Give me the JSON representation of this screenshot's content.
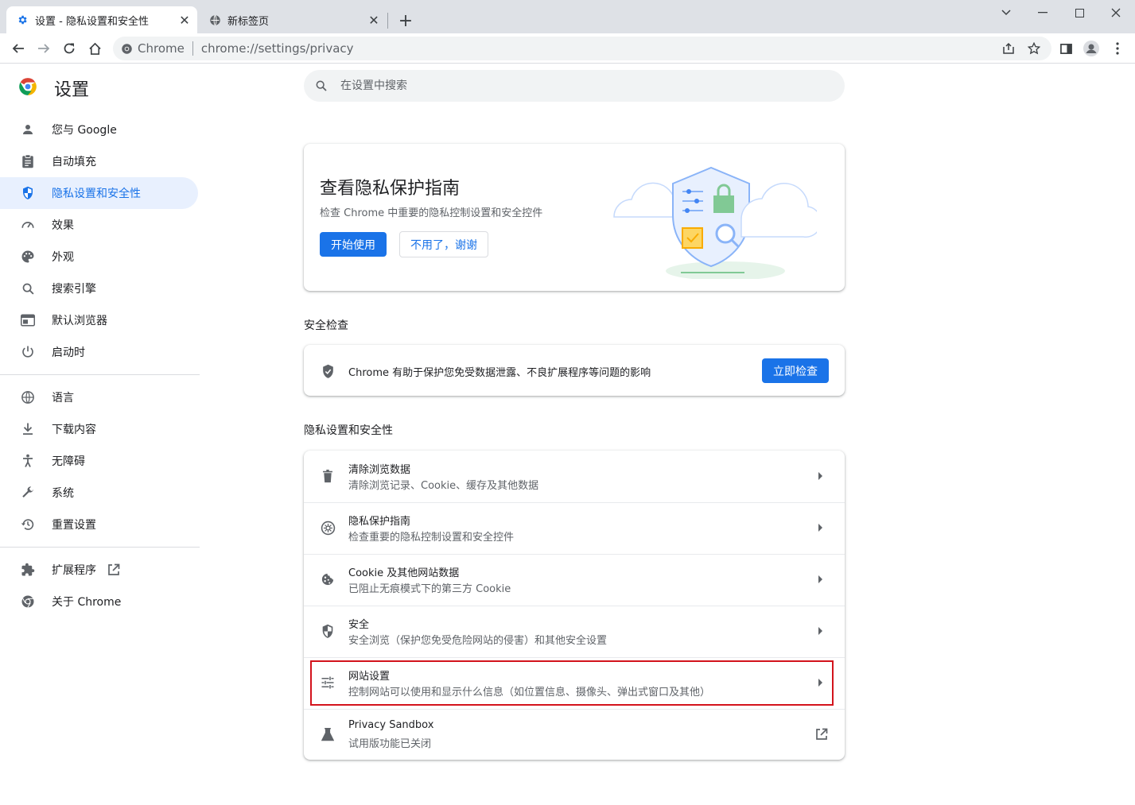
{
  "tabs": [
    {
      "title": "设置 - 隐私设置和安全性",
      "icon": "gear-icon",
      "active": true
    },
    {
      "title": "新标签页",
      "icon": "globe-icon",
      "active": false
    }
  ],
  "toolbar": {
    "omnibox_chip": "Chrome",
    "url": "chrome://settings/privacy"
  },
  "sidebar": {
    "title": "设置",
    "items": [
      {
        "label": "您与 Google",
        "icon": "person-icon"
      },
      {
        "label": "自动填充",
        "icon": "clipboard-icon"
      },
      {
        "label": "隐私设置和安全性",
        "icon": "shield-icon"
      },
      {
        "label": "效果",
        "icon": "speedometer-icon"
      },
      {
        "label": "外观",
        "icon": "palette-icon"
      },
      {
        "label": "搜索引擎",
        "icon": "search-icon"
      },
      {
        "label": "默认浏览器",
        "icon": "browser-icon"
      },
      {
        "label": "启动时",
        "icon": "power-icon"
      },
      {
        "label": "语言",
        "icon": "globe-icon"
      },
      {
        "label": "下载内容",
        "icon": "download-icon"
      },
      {
        "label": "无障碍",
        "icon": "accessibility-icon"
      },
      {
        "label": "系统",
        "icon": "wrench-icon"
      },
      {
        "label": "重置设置",
        "icon": "history-icon"
      },
      {
        "label": "扩展程序",
        "icon": "puzzle-icon"
      },
      {
        "label": "关于 Chrome",
        "icon": "chrome-icon"
      }
    ],
    "selected": "隐私设置和安全性"
  },
  "search": {
    "placeholder": "在设置中搜索"
  },
  "guide_card": {
    "title": "查看隐私保护指南",
    "subtitle": "检查 Chrome 中重要的隐私控制设置和安全控件",
    "primary_button": "开始使用",
    "secondary_button": "不用了，谢谢"
  },
  "safety_check": {
    "section_title": "安全检查",
    "text": "Chrome 有助于保护您免受数据泄露、不良扩展程序等问题的影响",
    "button": "立即检查"
  },
  "privacy_section": {
    "section_title": "隐私设置和安全性",
    "rows": [
      {
        "title": "清除浏览数据",
        "subtitle": "清除浏览记录、Cookie、缓存及其他数据",
        "icon": "trash-icon"
      },
      {
        "title": "隐私保护指南",
        "subtitle": "检查重要的隐私控制设置和安全控件",
        "icon": "compass-icon"
      },
      {
        "title": "Cookie 及其他网站数据",
        "subtitle": "已阻止无痕模式下的第三方 Cookie",
        "icon": "cookie-icon"
      },
      {
        "title": "安全",
        "subtitle": "安全浏览（保护您免受危险网站的侵害）和其他安全设置",
        "icon": "shield-icon"
      },
      {
        "title": "网站设置",
        "subtitle": "控制网站可以使用和显示什么信息（如位置信息、摄像头、弹出式窗口及其他）",
        "icon": "tune-icon"
      },
      {
        "title": "Privacy Sandbox",
        "subtitle": "试用版功能已关闭",
        "icon": "flask-icon"
      }
    ]
  },
  "colors": {
    "accent": "#1a73e8",
    "highlight": "#d3131c"
  }
}
